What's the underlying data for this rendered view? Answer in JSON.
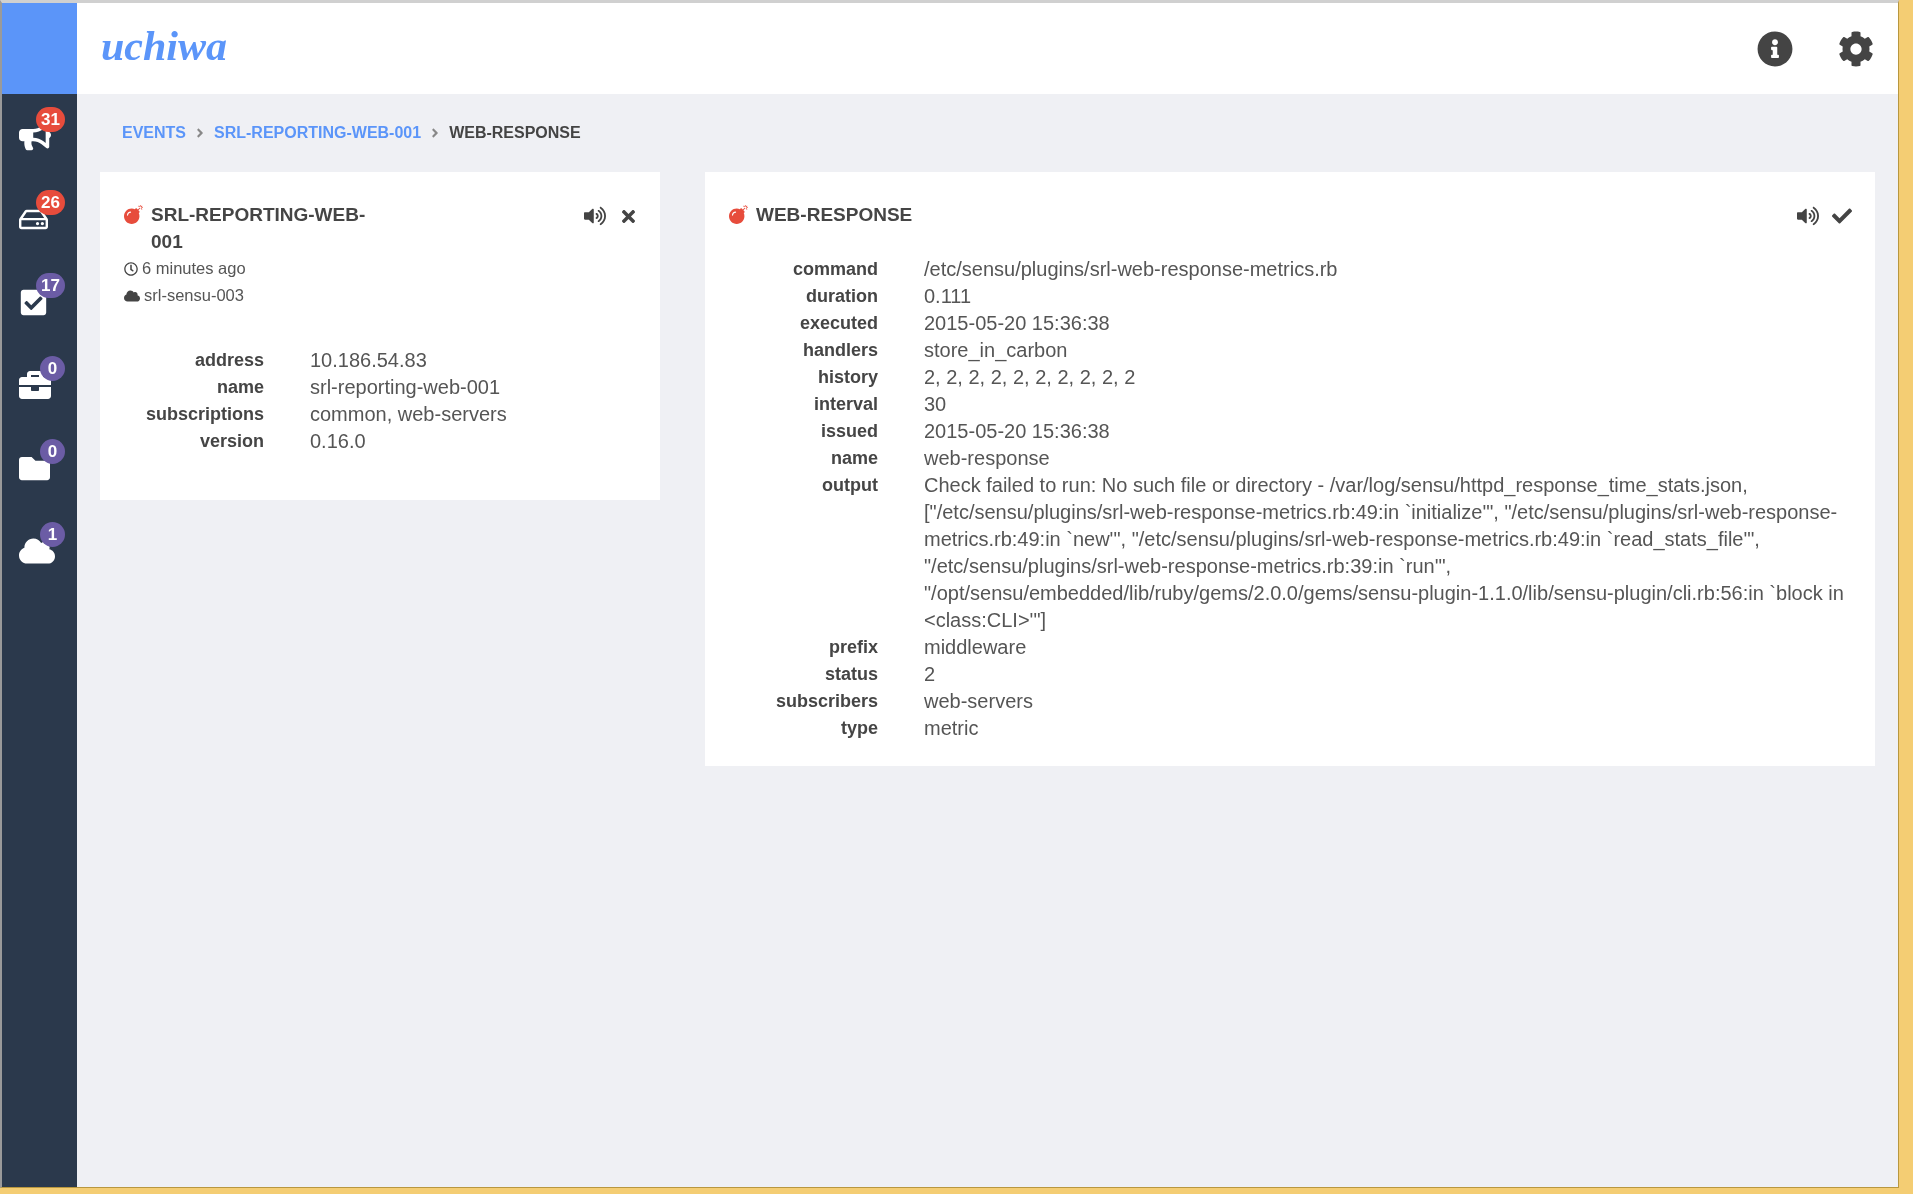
{
  "logo": "uchiwa",
  "sidebar": {
    "items": [
      {
        "badge": "31",
        "color": "#e74c3c"
      },
      {
        "badge": "26",
        "color": "#e74c3c"
      },
      {
        "badge": "17",
        "color": "#6b5ca5"
      },
      {
        "badge": "0",
        "color": "#6b5ca5"
      },
      {
        "badge": "0",
        "color": "#6b5ca5"
      },
      {
        "badge": "1",
        "color": "#6b5ca5"
      }
    ]
  },
  "breadcrumb": [
    {
      "label": "EVENTS",
      "current": false
    },
    {
      "label": "SRL-REPORTING-WEB-001",
      "current": false
    },
    {
      "label": "WEB-RESPONSE",
      "current": true
    }
  ],
  "client_panel": {
    "title": "SRL-REPORTING-WEB-001",
    "last_seen": "6 minutes ago",
    "datacenter": "srl-sensu-003",
    "fields": [
      {
        "label": "address",
        "value": "10.186.54.83"
      },
      {
        "label": "name",
        "value": "srl-reporting-web-001"
      },
      {
        "label": "subscriptions",
        "value": "common, web-servers"
      },
      {
        "label": "version",
        "value": "0.16.0"
      }
    ]
  },
  "check_panel": {
    "title": "WEB-RESPONSE",
    "fields": [
      {
        "label": "command",
        "value": "/etc/sensu/plugins/srl-web-response-metrics.rb"
      },
      {
        "label": "duration",
        "value": "0.111"
      },
      {
        "label": "executed",
        "value": "2015-05-20 15:36:38"
      },
      {
        "label": "handlers",
        "value": "store_in_carbon"
      },
      {
        "label": "history",
        "value": "2, 2, 2, 2, 2, 2, 2, 2, 2, 2"
      },
      {
        "label": "interval",
        "value": "30"
      },
      {
        "label": "issued",
        "value": "2015-05-20 15:36:38"
      },
      {
        "label": "name",
        "value": "web-response"
      },
      {
        "label": "output",
        "value": "Check failed to run: No such file or directory - /var/log/sensu/httpd_response_time_stats.json, [\"/etc/sensu/plugins/srl-web-response-metrics.rb:49:in `initialize'\", \"/etc/sensu/plugins/srl-web-response-metrics.rb:49:in `new'\", \"/etc/sensu/plugins/srl-web-response-metrics.rb:49:in `read_stats_file'\", \"/etc/sensu/plugins/srl-web-response-metrics.rb:39:in `run'\", \"/opt/sensu/embedded/lib/ruby/gems/2.0.0/gems/sensu-plugin-1.1.0/lib/sensu-plugin/cli.rb:56:in `block in <class:CLI>'\"]"
      },
      {
        "label": "prefix",
        "value": "middleware"
      },
      {
        "label": "status",
        "value": "2"
      },
      {
        "label": "subscribers",
        "value": "web-servers"
      },
      {
        "label": "type",
        "value": "metric"
      }
    ]
  }
}
